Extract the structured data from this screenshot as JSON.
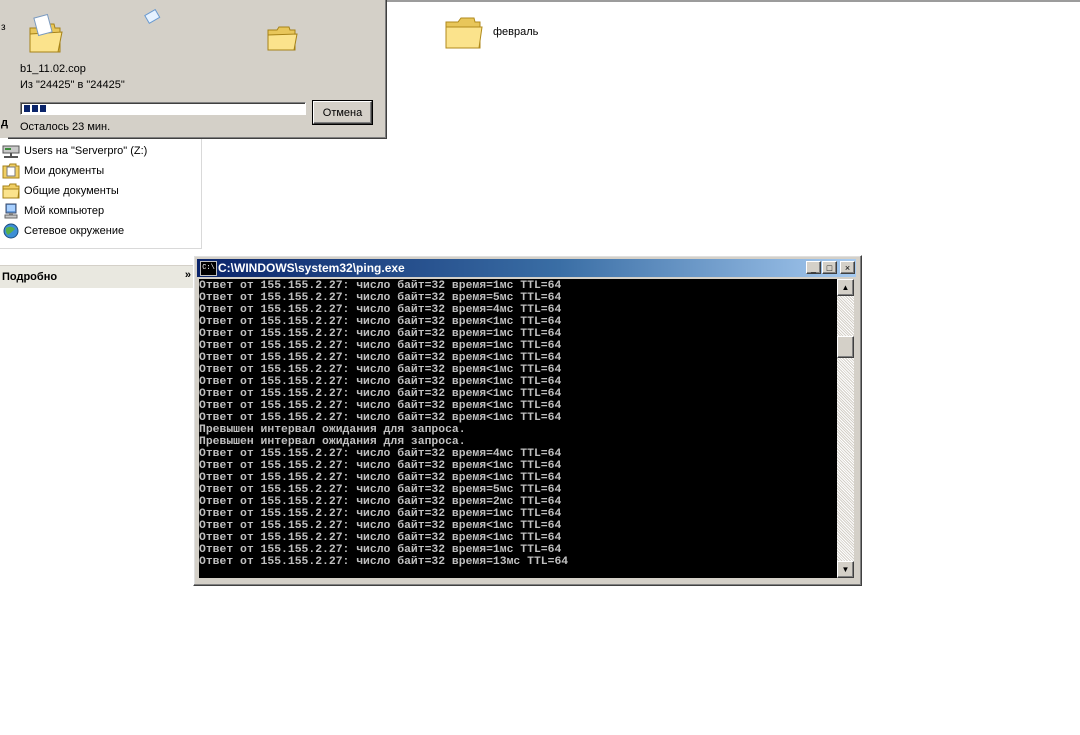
{
  "explorer": {
    "folder": {
      "name": "февраль",
      "icon": "folder-icon"
    }
  },
  "left_pane": {
    "items": [
      {
        "label": "Users на \"Serverpro\" (Z:)",
        "icon": "network-drive-icon"
      },
      {
        "label": "Мои документы",
        "icon": "my-documents-icon"
      },
      {
        "label": "Общие документы",
        "icon": "folder-icon"
      },
      {
        "label": "Мой компьютер",
        "icon": "my-computer-icon"
      },
      {
        "label": "Сетевое окружение",
        "icon": "network-places-icon"
      }
    ],
    "details": {
      "label": "Подробно",
      "chevron": "»"
    },
    "sliver_labels": {
      "top": "з",
      "bottom": "д"
    }
  },
  "copy_dialog": {
    "filename": "b1_11.02.cop",
    "from_to": "Из \"24425\" в \"24425\"",
    "remaining": "Осталось 23 мин.",
    "cancel_label": "Отмена",
    "progress_fraction": 0.08
  },
  "console": {
    "title": "C:\\WINDOWS\\system32\\ping.exe",
    "icon_text": "C:\\",
    "buttons": {
      "minimize": "_",
      "maximize": "□",
      "close": "×"
    },
    "scroll": {
      "up": "▲",
      "down": "▼"
    },
    "lines": [
      "Ответ от 155.155.2.27: число байт=32 время=1мс TTL=64",
      "Ответ от 155.155.2.27: число байт=32 время=5мс TTL=64",
      "Ответ от 155.155.2.27: число байт=32 время=4мс TTL=64",
      "Ответ от 155.155.2.27: число байт=32 время<1мс TTL=64",
      "Ответ от 155.155.2.27: число байт=32 время=1мс TTL=64",
      "Ответ от 155.155.2.27: число байт=32 время=1мс TTL=64",
      "Ответ от 155.155.2.27: число байт=32 время<1мс TTL=64",
      "Ответ от 155.155.2.27: число байт=32 время<1мс TTL=64",
      "Ответ от 155.155.2.27: число байт=32 время<1мс TTL=64",
      "Ответ от 155.155.2.27: число байт=32 время<1мс TTL=64",
      "Ответ от 155.155.2.27: число байт=32 время<1мс TTL=64",
      "Ответ от 155.155.2.27: число байт=32 время<1мс TTL=64",
      "Превышен интервал ожидания для запроса.",
      "Превышен интервал ожидания для запроса.",
      "Ответ от 155.155.2.27: число байт=32 время=4мс TTL=64",
      "Ответ от 155.155.2.27: число байт=32 время<1мс TTL=64",
      "Ответ от 155.155.2.27: число байт=32 время<1мс TTL=64",
      "Ответ от 155.155.2.27: число байт=32 время=5мс TTL=64",
      "Ответ от 155.155.2.27: число байт=32 время=2мс TTL=64",
      "Ответ от 155.155.2.27: число байт=32 время=1мс TTL=64",
      "Ответ от 155.155.2.27: число байт=32 время<1мс TTL=64",
      "Ответ от 155.155.2.27: число байт=32 время<1мс TTL=64",
      "Ответ от 155.155.2.27: число байт=32 время=1мс TTL=64",
      "Ответ от 155.155.2.27: число байт=32 время=13мс TTL=64"
    ]
  },
  "colors": {
    "titlebar_active": "#0a246a",
    "window_face": "#d4d0c8",
    "console_bg": "#000000",
    "console_fg": "#c0c0c0",
    "progress_block": "#0a246a"
  }
}
